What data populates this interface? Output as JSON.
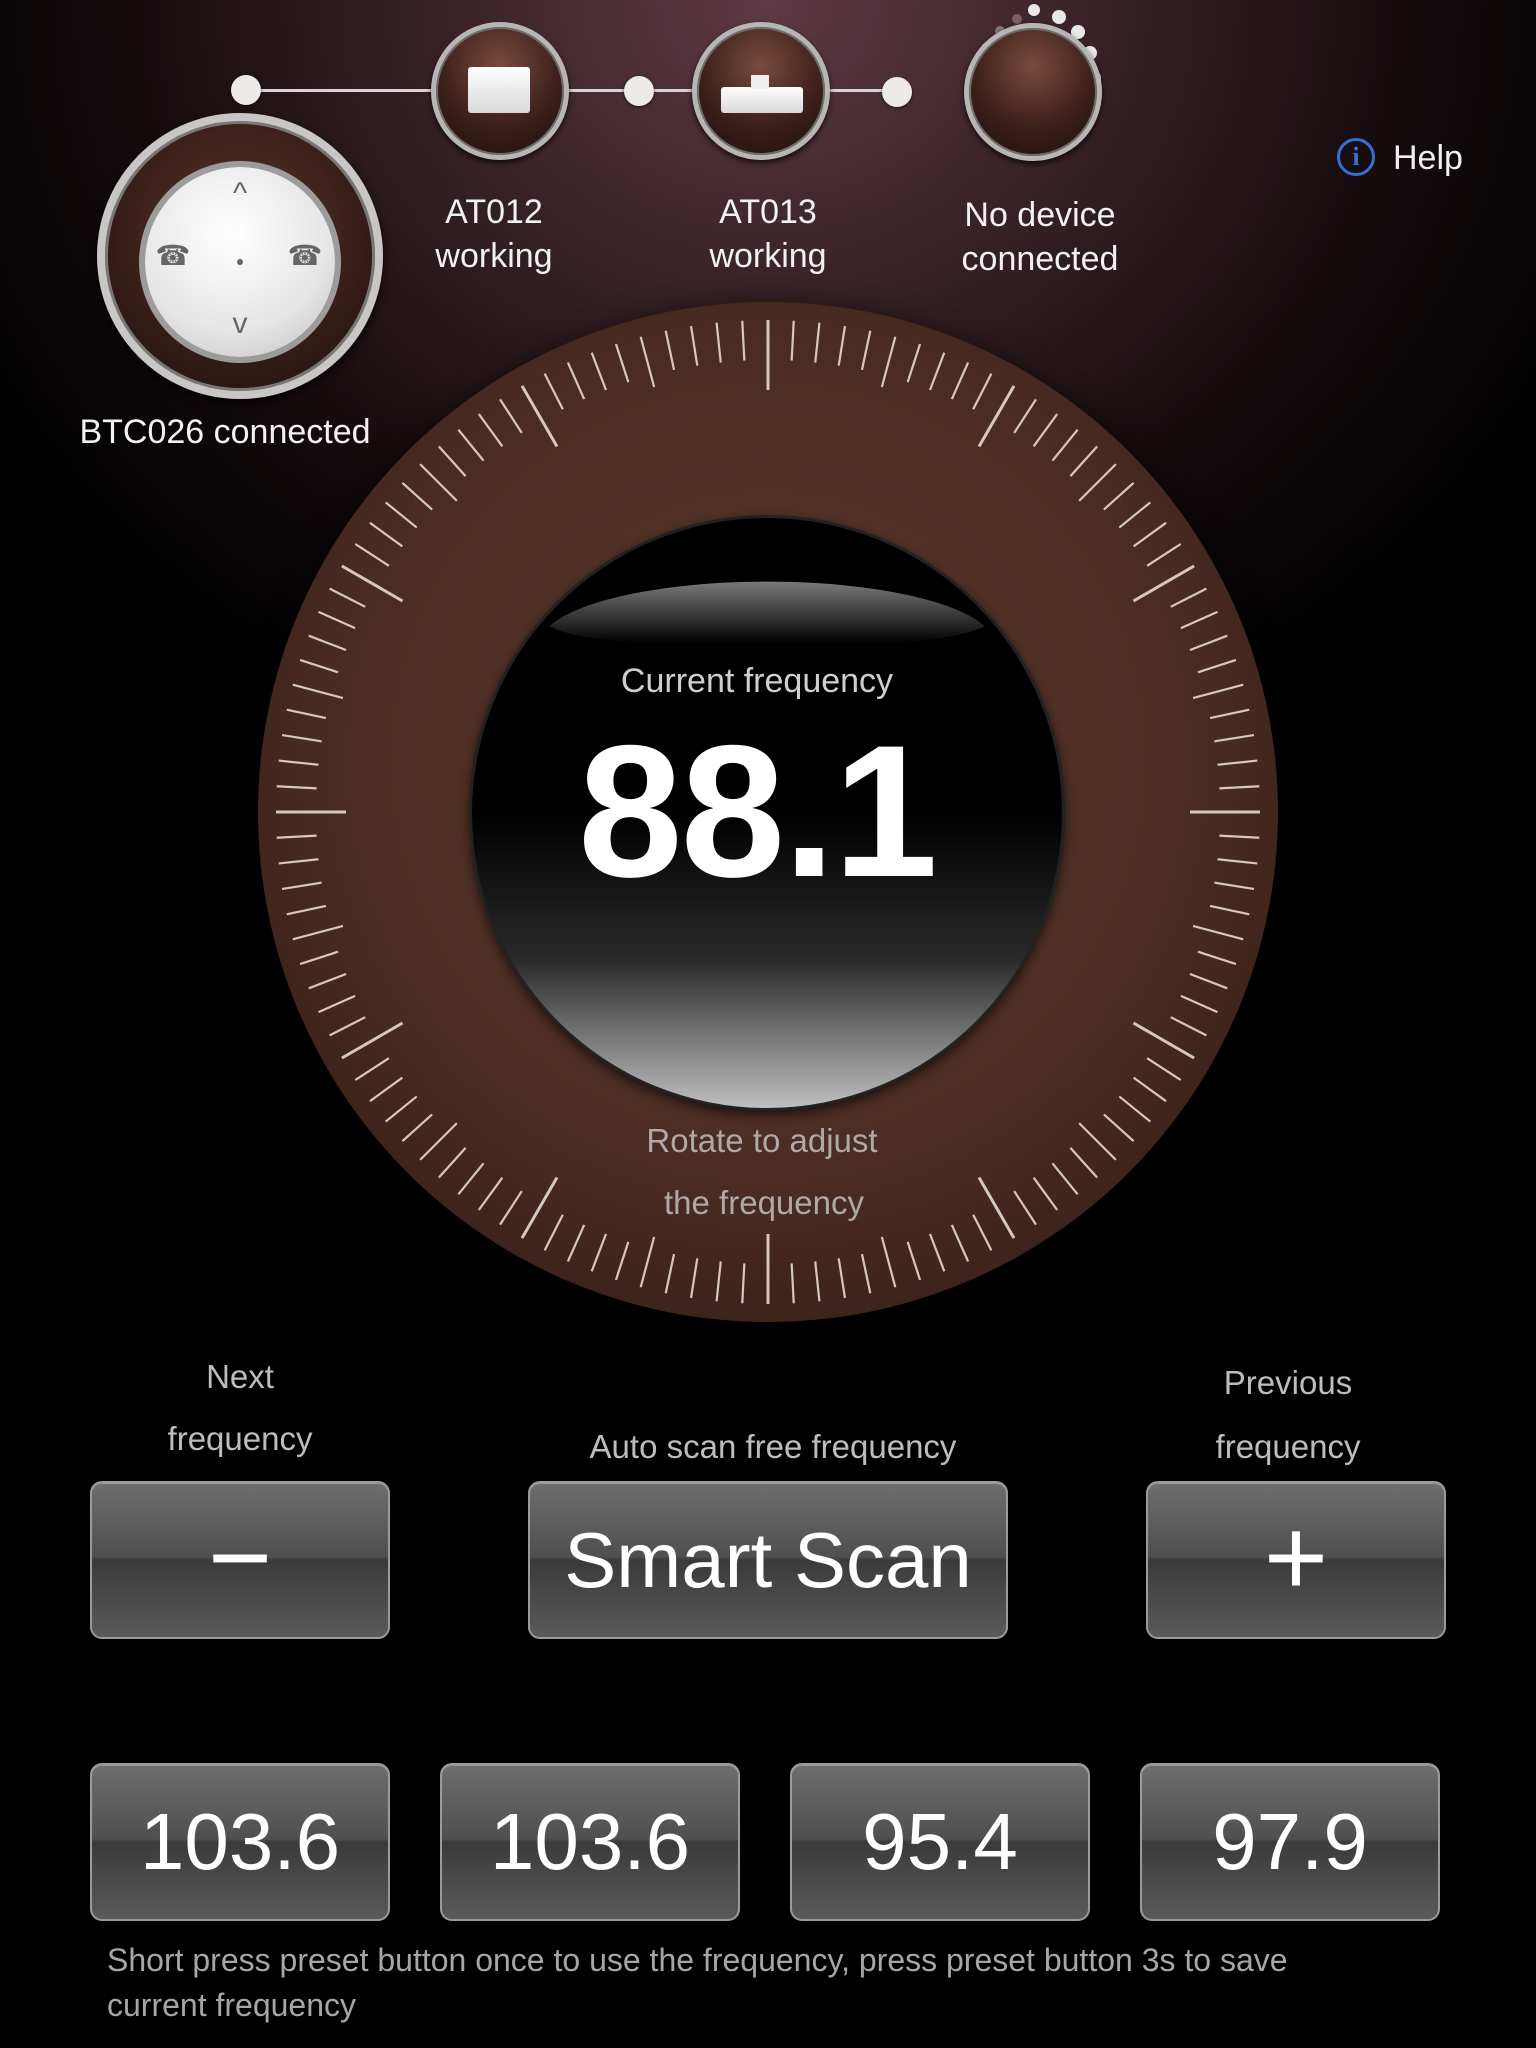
{
  "devices": {
    "remote_label": "BTC026 connected",
    "items": [
      {
        "name": "AT012",
        "status": "working"
      },
      {
        "name": "AT013",
        "status": "working"
      },
      {
        "name": "No device",
        "status": "connected"
      }
    ]
  },
  "help": {
    "label": "Help",
    "icon": "info-icon",
    "icon_glyph": "i"
  },
  "dial": {
    "caption": "Current frequency",
    "frequency": "88.1",
    "hint_line1": "Rotate to adjust",
    "hint_line2": "the frequency"
  },
  "controls": {
    "next_caption_line1": "Next",
    "next_caption_line2": "frequency",
    "next_symbol": "−",
    "scan_caption": "Auto scan free frequency",
    "scan_label": "Smart Scan",
    "prev_caption_line1": "Previous",
    "prev_caption_line2": "frequency",
    "prev_symbol": "+"
  },
  "presets": [
    "103.6",
    "103.6",
    "95.4",
    "97.9"
  ],
  "footnote_line1": "Short press preset button once to use the frequency, press preset button 3s to save",
  "footnote_line2": "current frequency",
  "colors": {
    "accent": "#2e72d8",
    "background": "#3a2328"
  }
}
